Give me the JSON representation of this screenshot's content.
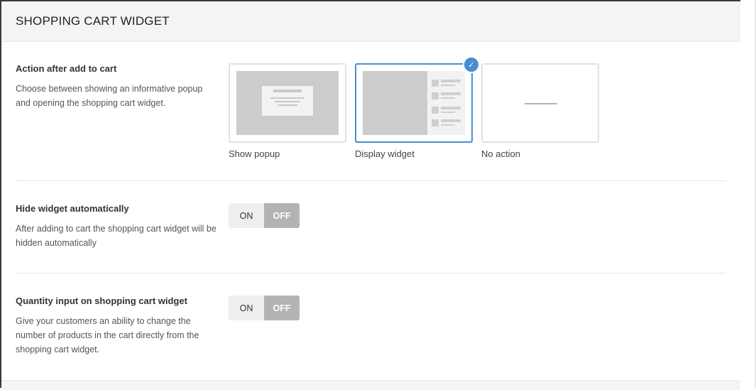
{
  "header": {
    "title": "SHOPPING CART WIDGET"
  },
  "sections": [
    {
      "label": "Action after add to cart",
      "description": "Choose between showing an informative popup and opening the shopping cart widget.",
      "options": [
        {
          "label": "Show popup",
          "selected": false
        },
        {
          "label": "Display widget",
          "selected": true
        },
        {
          "label": "No action",
          "selected": false
        }
      ],
      "selected_icon": "check-icon"
    },
    {
      "label": "Hide widget automatically",
      "description": "After adding to cart the shopping cart widget will be hidden automatically",
      "toggle": {
        "on_label": "ON",
        "off_label": "OFF",
        "value": "OFF"
      }
    },
    {
      "label": "Quantity input on shopping cart widget",
      "description": "Give your customers an ability to change the number of products in the cart directly from the shopping cart widget.",
      "toggle": {
        "on_label": "ON",
        "off_label": "OFF",
        "value": "OFF"
      }
    }
  ],
  "colors": {
    "accent": "#4a8dd0",
    "toggle_off_active": "#b3b3b3",
    "header_bg": "#f4f4f4"
  }
}
